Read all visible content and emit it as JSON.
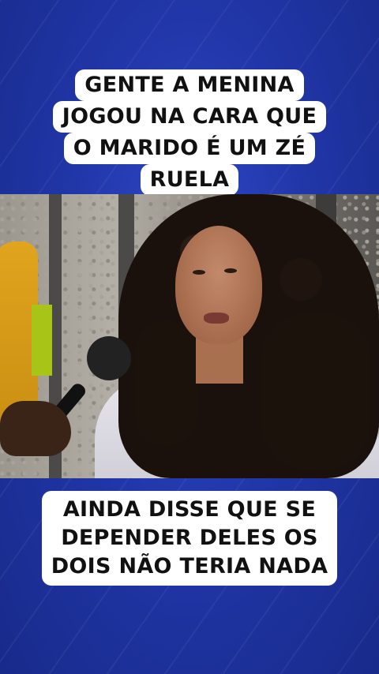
{
  "caption_top": {
    "lines": [
      "GENTE A MENINA",
      "JOGOU NA CARA QUE",
      "O MARIDO É UM ZÉ",
      "RUELA"
    ]
  },
  "caption_bottom": {
    "lines": [
      "AINDA DISSE QUE SE",
      "DEPENDER DELES OS",
      "DOIS NÃO TERIA NADA"
    ]
  },
  "colors": {
    "background": "#2136a8",
    "caption_bg": "#ffffff",
    "caption_text": "#111111"
  }
}
